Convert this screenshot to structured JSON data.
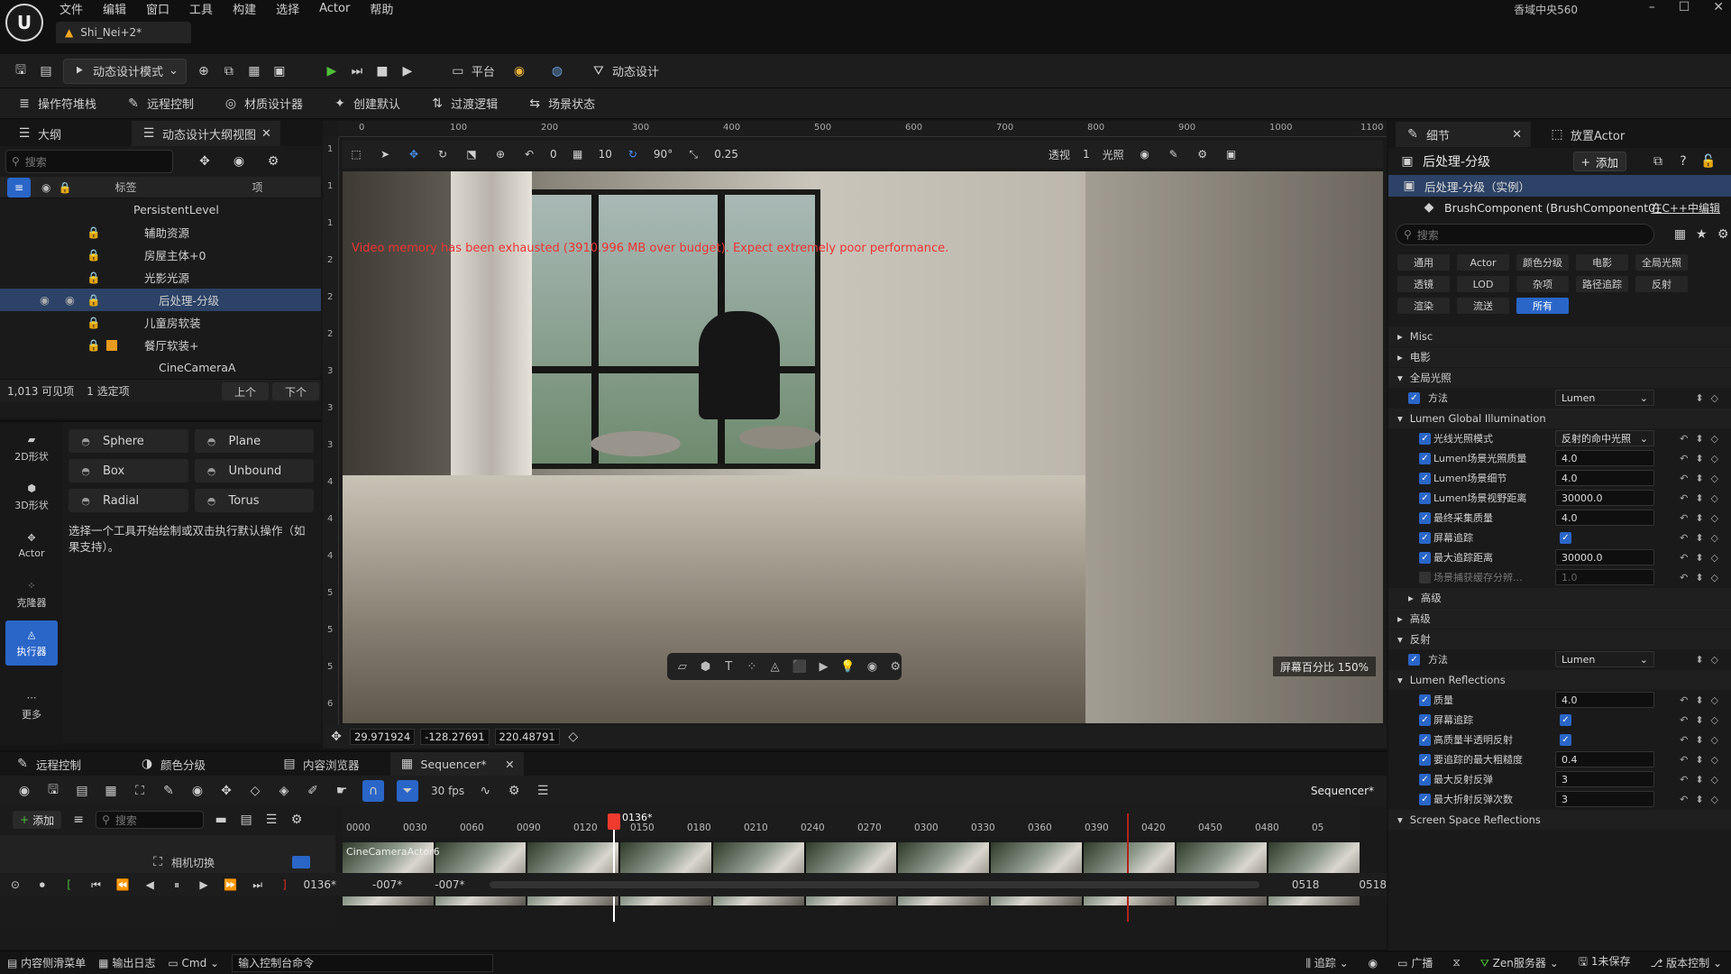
{
  "app": {
    "project": "香域中央560",
    "doc_tab": "Shi_Nei+2*"
  },
  "menu": [
    "文件",
    "编辑",
    "窗口",
    "工具",
    "构建",
    "选择",
    "Actor",
    "帮助"
  ],
  "toolbar1": {
    "mode": "动态设计模式",
    "platform": "平台",
    "dyn": "动态设计"
  },
  "toolbar2": [
    "操作符堆栈",
    "远程控制",
    "材质设计器",
    "创建默认",
    "过渡逻辑",
    "场景状态"
  ],
  "outliner": {
    "tab1": "大纲",
    "tab2": "动态设计大纲视图",
    "search_placeholder": "搜索",
    "col_label": "标签",
    "col_item": "项",
    "rows": [
      {
        "label": "PersistentLevel"
      },
      {
        "label": "辅助资源"
      },
      {
        "label": "房屋主体+0"
      },
      {
        "label": "光影光源"
      },
      {
        "label": "后处理-分级"
      },
      {
        "label": "儿童房软装"
      },
      {
        "label": "餐厅软装+"
      },
      {
        "label": "CineCameraA"
      }
    ],
    "visible": "1,013 可见项",
    "selected": "1 选定项",
    "prev": "上个",
    "next": "下个"
  },
  "modes": {
    "items": [
      {
        "label": "2D形状"
      },
      {
        "label": "3D形状"
      },
      {
        "label": "Actor"
      },
      {
        "label": "克隆器"
      },
      {
        "label": "执行器"
      },
      {
        "label": "更多"
      }
    ],
    "shapes": [
      "Sphere",
      "Plane",
      "Box",
      "Unbound",
      "Radial",
      "Torus"
    ],
    "hint": "选择一个工具开始绘制或双击执行默认操作（如果支持）。"
  },
  "viewport": {
    "ruler_top": [
      "0",
      "100",
      "200",
      "300",
      "400",
      "500",
      "600",
      "700",
      "800",
      "900",
      "1000",
      "1100"
    ],
    "ruler_left": [
      "1",
      "1",
      "1",
      "2",
      "2",
      "2",
      "3",
      "3",
      "3",
      "4",
      "4",
      "4",
      "5",
      "5",
      "5",
      "6"
    ],
    "snap_grid": "10",
    "snap_rot": "90°",
    "snap_scale": "0.25",
    "rot_val": "0",
    "view_mode": "透视",
    "lighting": "光照",
    "layers": "1",
    "warning": "Video memory has been exhausted (3910.996 MB over budget). Expect extremely poor performance.",
    "screen_pct": "屏幕百分比 150%",
    "coords": [
      "29.971924",
      "-128.27691",
      "220.48791"
    ]
  },
  "details": {
    "tab1": "细节",
    "tab2": "放置Actor",
    "title": "后处理-分级",
    "add": "添加",
    "instance": "后处理-分级（实例）",
    "component": "BrushComponent (BrushComponent0)",
    "cpp": "在C++中编辑",
    "search_placeholder": "搜索",
    "filters": [
      "通用",
      "Actor",
      "颜色分级",
      "电影",
      "全局光照",
      "透镜",
      "LOD",
      "杂项",
      "路径追踪",
      "反射",
      "渲染",
      "流送",
      "所有"
    ],
    "sections": {
      "misc": "Misc",
      "film": "电影",
      "gi": "全局光照",
      "lumen_gi": "Lumen Global Illumination",
      "advanced1": "高级",
      "advanced2": "高级",
      "reflections": "反射",
      "lumen_refl": "Lumen Reflections",
      "ssr": "Screen Space Reflections"
    },
    "gi_method": {
      "label": "方法",
      "value": "Lumen"
    },
    "gi_props": [
      {
        "label": "光线光照模式",
        "value": "反射的命中光照",
        "drop": true
      },
      {
        "label": "Lumen场景光照质量",
        "value": "4.0"
      },
      {
        "label": "Lumen场景细节",
        "value": "4.0"
      },
      {
        "label": "Lumen场景视野距离",
        "value": "30000.0"
      },
      {
        "label": "最终采集质量",
        "value": "4.0"
      },
      {
        "label": "屏幕追踪",
        "value": "✓"
      },
      {
        "label": "最大追踪距离",
        "value": "30000.0"
      },
      {
        "label": "场景捕获缓存分辨...",
        "value": "1.0"
      }
    ],
    "refl_method": {
      "label": "方法",
      "value": "Lumen"
    },
    "refl_props": [
      {
        "label": "质量",
        "value": "4.0"
      },
      {
        "label": "屏幕追踪",
        "value": "✓"
      },
      {
        "label": "高质量半透明反射",
        "value": "✓"
      },
      {
        "label": "要追踪的最大粗糙度",
        "value": "0.4"
      },
      {
        "label": "最大反射反弹",
        "value": "3"
      },
      {
        "label": "最大折射反弹次数",
        "value": "3"
      }
    ]
  },
  "bottom": {
    "tabs": [
      "远程控制",
      "颜色分级",
      "内容浏览器",
      "Sequencer*"
    ],
    "fps": "30 fps",
    "seq_name": "Sequencer*",
    "add": "添加",
    "search_placeholder": "搜索",
    "track": "相机切换",
    "playhead": "0136*",
    "clip_label": "CineCameraActor6",
    "ticks": [
      "0000",
      "0030",
      "0060",
      "0090",
      "0120",
      "0150",
      "0180",
      "0210",
      "0240",
      "0270",
      "0300",
      "0330",
      "0360",
      "0390",
      "0420",
      "0450",
      "0480",
      "05"
    ],
    "transport_frame": "0136*",
    "range_start": "-007*",
    "range_start2": "-007*",
    "range_end": "0518",
    "range_end2": "0518"
  },
  "statusbar": {
    "drawer": "内容侧滑菜单",
    "log": "输出日志",
    "cmd": "Cmd",
    "cmd_placeholder": "输入控制台命令",
    "trace": "追踪",
    "broadcast": "广播",
    "zen": "Zen服务器",
    "unsaved": "1未保存",
    "vcs": "版本控制"
  },
  "colors": {
    "accent": "#2a66c8",
    "play": "#4fbf3a",
    "record": "#e0302a",
    "warning": "#e33333"
  }
}
